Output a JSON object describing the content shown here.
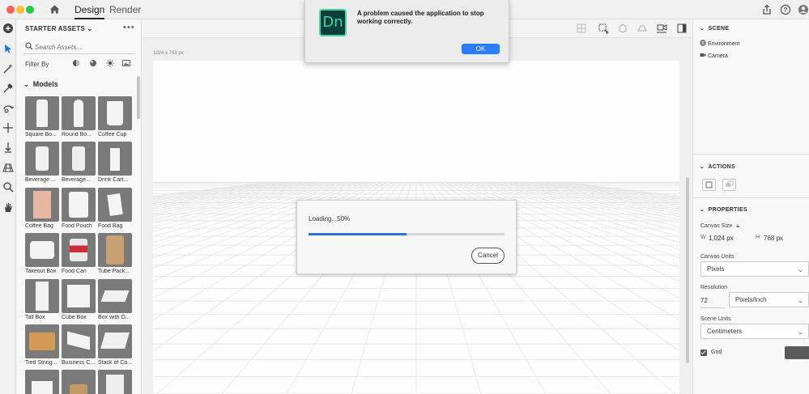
{
  "window": {
    "tabs": [
      "Design",
      "Render"
    ]
  },
  "assets": {
    "header": "STARTER ASSETS",
    "search_placeholder": "Search Assets...",
    "filter_label": "Filter By",
    "section_title": "Models",
    "items": [
      "Square Bo...",
      "Round Bo...",
      "Coffee Cup",
      "Beverage ...",
      "Beverage...",
      "Drink Cart...",
      "Coffee Bag",
      "Food Pouch",
      "Food Bag",
      "Takeout Box",
      "Food Can",
      "Tube Pack...",
      "Tall Box",
      "Cube Box",
      "Box with O...",
      "Tied String...",
      "Business C...",
      "Stack of Ca..."
    ]
  },
  "canvas": {
    "size_label": "1024 x 768 px"
  },
  "loading_dialog": {
    "text": "Loading...50%",
    "progress": 0.5,
    "cancel_label": "Cancel"
  },
  "alert": {
    "app_logo_text": "Dn",
    "message": "A problem caused the application to stop working correctly.",
    "ok_label": "OK"
  },
  "right_panel": {
    "scene_header": "SCENE",
    "scene_items": [
      "Environment",
      "Camera"
    ],
    "actions_header": "ACTIONS",
    "properties_header": "PROPERTIES",
    "canvas_size_label": "Canvas Size",
    "width_label": "W",
    "width_value": "1,024 px",
    "height_label": "H",
    "height_value": "768 px",
    "canvas_units_label": "Canvas Units",
    "canvas_units_value": "Pixels",
    "resolution_label": "Resolution",
    "resolution_value": "72",
    "resolution_unit": "Pixels/Inch",
    "scene_units_label": "Scene Units",
    "scene_units_value": "Centimeters",
    "grid_label": "Grid"
  },
  "colors": {
    "accent_blue": "#2d72d9",
    "ok_blue": "#2a7cf7",
    "dn_teal": "#3ed7a1"
  }
}
